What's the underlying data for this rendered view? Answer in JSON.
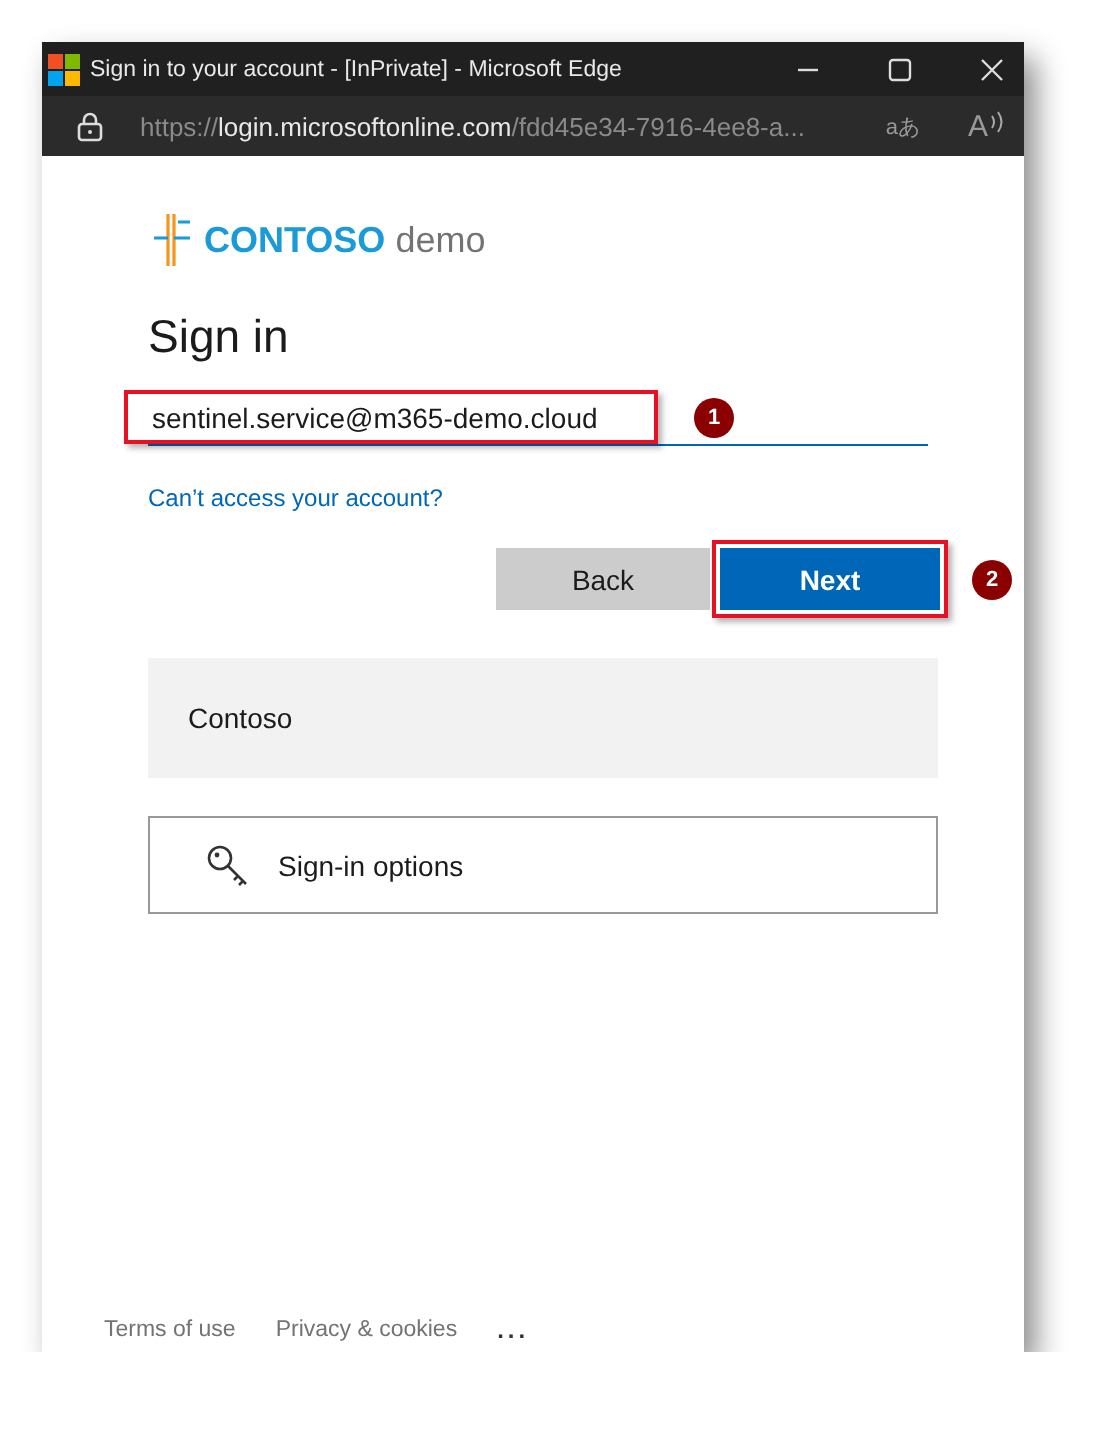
{
  "window": {
    "title": "Sign in to your account - [InPrivate] - Microsoft Edge"
  },
  "address_bar": {
    "scheme": "https://",
    "host": "login.microsoftonline.com",
    "path": "/fdd45e34-7916-4ee8-a...",
    "translate_glyph": "aあ",
    "read_aloud_glyph": "A"
  },
  "logo": {
    "brand": "CONTOSO",
    "suffix": "demo"
  },
  "heading": "Sign in",
  "email_field": {
    "value": "sentinel.service@m365-demo.cloud"
  },
  "help_link": "Can’t access your account?",
  "buttons": [
    {
      "label": "Back",
      "kind": "secondary"
    },
    {
      "label": "Next",
      "kind": "primary"
    }
  ],
  "tenant_tile": "Contoso",
  "options_button": "Sign-in options",
  "footer": {
    "links": [
      "Terms of use",
      "Privacy & cookies"
    ],
    "more": "..."
  },
  "annotations": [
    {
      "label": "1"
    },
    {
      "label": "2"
    }
  ]
}
